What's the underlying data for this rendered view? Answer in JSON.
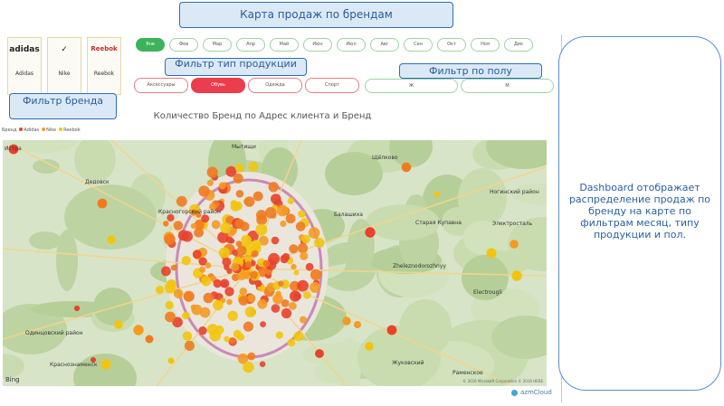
{
  "callouts": {
    "title": "Карта продаж по брендам",
    "product_type": "Фильтр тип продукции",
    "gender": "Фильтр по полу",
    "brand": "Фильтр бренда"
  },
  "brand_filter": {
    "tiles": [
      {
        "logo": "adidas",
        "name": "Adidas"
      },
      {
        "logo": "✓",
        "name": "Nike"
      },
      {
        "logo": "Reebok",
        "name": "Reebok"
      }
    ]
  },
  "month_filter": {
    "items": [
      "Янв",
      "Фев",
      "Мар",
      "Апр",
      "Май",
      "Июн",
      "Июл",
      "Авг",
      "Сен",
      "Окт",
      "Ноя",
      "Дек"
    ],
    "active_index": 0
  },
  "product_type_filter": {
    "items": [
      "Аксессуары",
      "Обувь",
      "Одежда",
      "Спорт"
    ],
    "active_index": 1
  },
  "gender_filter": {
    "items": [
      "Ж",
      "М"
    ]
  },
  "map": {
    "title": "Количество Бренд по Адрес клиента и Бренд",
    "legend_label": "Бренд",
    "legend": [
      {
        "name": "Adidas",
        "color": "#e8412c"
      },
      {
        "name": "Nike",
        "color": "#f59a23"
      },
      {
        "name": "Reebok",
        "color": "#f2c40f"
      }
    ],
    "places": [
      {
        "name": "Истра"
      },
      {
        "name": "Мытищи"
      },
      {
        "name": "Щёлково"
      },
      {
        "name": "Дедовск"
      },
      {
        "name": "Красногорский район"
      },
      {
        "name": "Балашиха"
      },
      {
        "name": "Ногинский район"
      },
      {
        "name": "Старая Купавна"
      },
      {
        "name": "Электросталь"
      },
      {
        "name": "Zheleznodorozhnyy"
      },
      {
        "name": "Одинцовский район"
      },
      {
        "name": "Краснознаменск"
      },
      {
        "name": "Жуковский"
      },
      {
        "name": "Electrougli"
      },
      {
        "name": "Раменское"
      }
    ],
    "provider": "Bing",
    "credits": "© 2016 Microsoft Corporation © 2016 HERE"
  },
  "brand_logo": "azmCloud",
  "description": "Dashboard отображает распределение продаж по бренду на карте по фильтрам месяц, типу продукции и пол."
}
